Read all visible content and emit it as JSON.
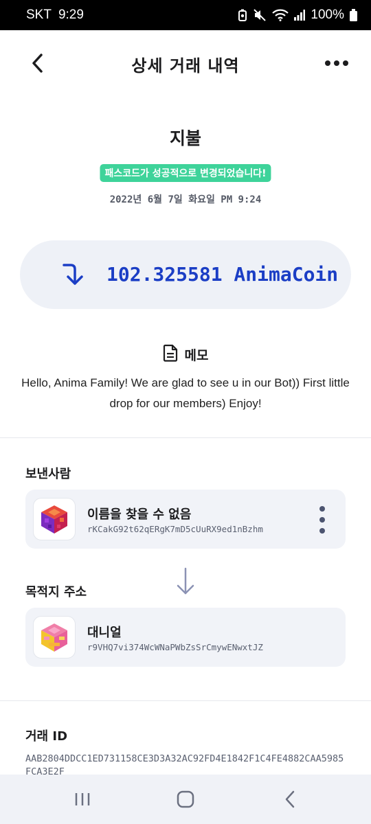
{
  "status_bar": {
    "carrier": "SKT",
    "time": "9:29",
    "battery": "100%"
  },
  "header": {
    "title": "상세 거래 내역",
    "back_icon": "chevron-left-icon",
    "more_icon": "more-horizontal-icon"
  },
  "transaction": {
    "type": "지불",
    "toast": "패스코드가 성공적으로 변경되었습니다!",
    "date": "2022년 6월 7일 화요일 PM 9:24",
    "amount": "102.325581 AnimaCoin",
    "direction_icon": "arrow-incoming-icon"
  },
  "memo": {
    "title": "메모",
    "icon": "document-icon",
    "text": "Hello, Anima Family!  We are glad to see u in our Bot)) First little drop for our members) Enjoy!"
  },
  "sender": {
    "label": "보낸사람",
    "name": "이름을 찾을 수 없음",
    "address": "rKCakG92t62qERgK7mD5cUuRX9ed1nBzhm"
  },
  "destination": {
    "label": "목적지 주소",
    "name": "대니얼",
    "address": "r9VHQ7vi374WcWNaPWbZsSrCmywENwxtJZ"
  },
  "transaction_id": {
    "label": "거래 ID",
    "value": "AAB2804DDCC1ED731158CE3D3A32AC92FD4E1842F1C4FE4882CAA5985FCA3E2F"
  },
  "colors": {
    "accent": "#1b3ec5",
    "toast": "#3ed39a",
    "card_bg": "#f1f3f8"
  }
}
